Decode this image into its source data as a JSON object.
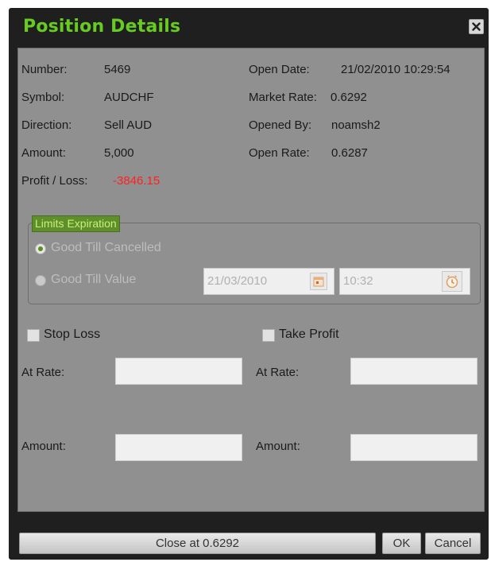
{
  "window": {
    "title": "Position Details"
  },
  "details": {
    "number": {
      "label": "Number:",
      "value": "5469"
    },
    "symbol": {
      "label": "Symbol:",
      "value": "AUDCHF"
    },
    "direction": {
      "label": "Direction:",
      "value": "Sell AUD"
    },
    "amount": {
      "label": "Amount:",
      "value": "5,000"
    },
    "profit_loss": {
      "label": "Profit / Loss:",
      "value": "-3846.15"
    },
    "open_date": {
      "label": "Open Date:",
      "value": "21/02/2010 10:29:54"
    },
    "market_rate": {
      "label": "Market Rate:",
      "value": "0.6292"
    },
    "opened_by": {
      "label": "Opened By:",
      "value": "noamsh2"
    },
    "open_rate": {
      "label": "Open Rate:",
      "value": "0.6287"
    }
  },
  "limits": {
    "legend": "Limits Expiration",
    "good_till_cancelled": "Good Till Cancelled",
    "good_till_value": "Good Till Value",
    "date": "21/03/2010",
    "time": "10:32"
  },
  "stop_loss": {
    "label": "Stop Loss",
    "at_rate": "At Rate:",
    "amount": "Amount:"
  },
  "take_profit": {
    "label": "Take Profit",
    "at_rate": "At Rate:",
    "amount": "Amount:"
  },
  "buttons": {
    "close_at": "Close at 0.6292",
    "ok": "OK",
    "cancel": "Cancel"
  },
  "colors": {
    "title": "#66cc22",
    "loss": "#ff2020",
    "accent_green": "#5f8f2a"
  },
  "icons": {
    "close": "close-icon",
    "calendar": "calendar-icon",
    "clock": "clock-icon"
  }
}
